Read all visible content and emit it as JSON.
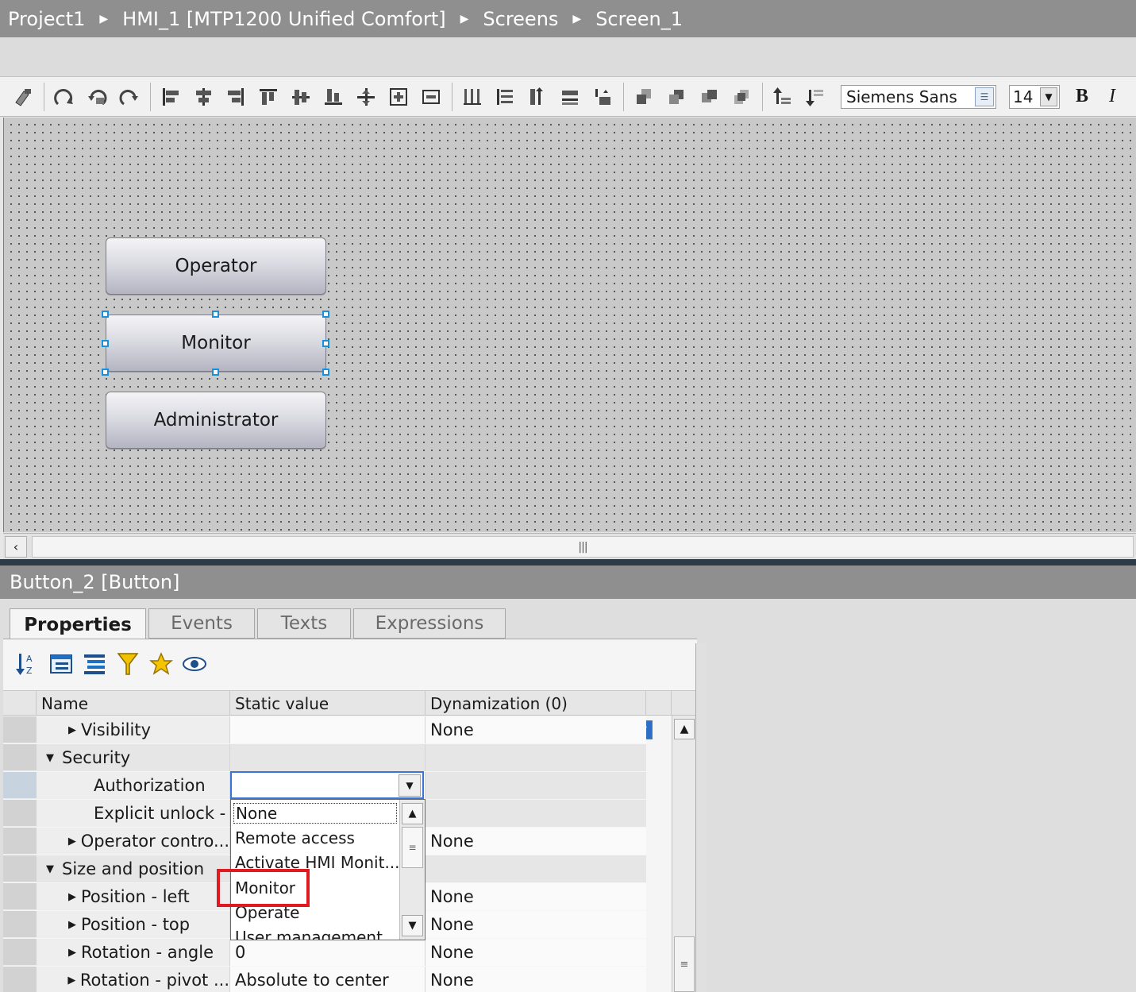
{
  "breadcrumb": [
    "Project1",
    "HMI_1 [MTP1200 Unified Comfort]",
    "Screens",
    "Screen_1"
  ],
  "toolbar": {
    "icons": [
      "format-painter-icon",
      "rotate-icon",
      "rotate-left-icon",
      "rotate-right-icon",
      "align-left-icon",
      "align-center-icon",
      "align-right-icon",
      "align-top-icon",
      "align-middle-icon",
      "align-bottom-icon",
      "center-icon",
      "center-horizontal-icon",
      "center-vertical-icon",
      "distribute-horizontal-icon",
      "distribute-vertical-icon",
      "equal-height-icon",
      "equal-width-icon",
      "equal-size-icon",
      "bring-to-front-icon",
      "bring-forward-icon",
      "send-backward-icon",
      "send-to-back-icon",
      "move-up-layer-icon",
      "move-down-layer-icon"
    ],
    "font": "Siemens Sans",
    "font_size": "14",
    "bold": "B",
    "italic": "I"
  },
  "canvas": {
    "buttons": [
      {
        "label": "Operator",
        "selected": false
      },
      {
        "label": "Monitor",
        "selected": true
      },
      {
        "label": "Administrator",
        "selected": false
      }
    ]
  },
  "inspector": {
    "title": "Button_2 [Button]",
    "tabs": [
      "Properties",
      "Events",
      "Texts",
      "Expressions"
    ],
    "active_tab": "Properties",
    "tools": [
      "sort-az-icon",
      "expand-all-icon",
      "collapse-all-icon",
      "filter-icon",
      "favorite-icon",
      "show-icon"
    ],
    "columns": {
      "name": "Name",
      "static": "Static value",
      "dyn": "Dynamization (0)"
    },
    "rows": [
      {
        "name": "Visibility",
        "static": "",
        "dyn": "None",
        "indent": 1,
        "expander": "collapsed",
        "checkbox": true
      },
      {
        "name": "Security",
        "static": "",
        "dyn": "",
        "indent": 0,
        "expander": "expanded",
        "group": true
      },
      {
        "name": "Authorization",
        "static": "",
        "dyn": "",
        "indent": 1,
        "expander": ""
      },
      {
        "name": "Explicit unlock - ...",
        "static": "",
        "dyn": "",
        "indent": 1,
        "expander": ""
      },
      {
        "name": "Operator contro...",
        "static": "",
        "dyn": "None",
        "indent": 1,
        "expander": "collapsed"
      },
      {
        "name": "Size and position",
        "static": "",
        "dyn": "",
        "indent": 0,
        "expander": "expanded",
        "group": true
      },
      {
        "name": "Position - left",
        "static": "",
        "dyn": "None",
        "indent": 1,
        "expander": "collapsed"
      },
      {
        "name": "Position - top",
        "static": "",
        "dyn": "None",
        "indent": 1,
        "expander": "collapsed"
      },
      {
        "name": "Rotation - angle",
        "static": "0",
        "dyn": "None",
        "indent": 1,
        "expander": "collapsed"
      },
      {
        "name": "Rotation - pivot ...",
        "static": "Absolute to center",
        "dyn": "None",
        "indent": 1,
        "expander": "collapsed"
      }
    ],
    "dropdown": {
      "value": "",
      "options": [
        "None",
        "Remote access",
        "Activate HMI Monit...",
        "Monitor",
        "Operate",
        "User management"
      ],
      "highlighted": "Monitor"
    }
  },
  "colors": {
    "title_bg": "#8f8f8f",
    "selection_handle": "#1b8fd8",
    "highlight_box": "#e11921",
    "divider": "#2d3a48"
  }
}
